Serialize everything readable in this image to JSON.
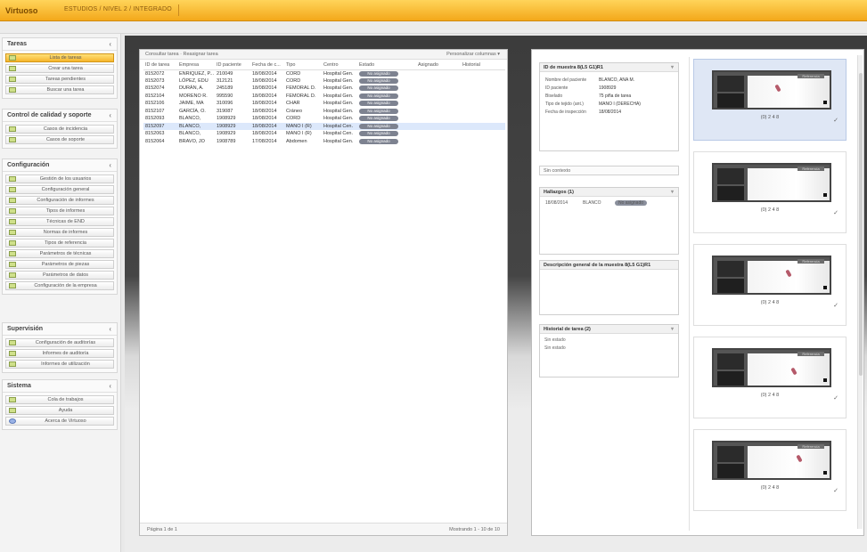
{
  "app": {
    "brand": "Virtuoso",
    "breadcrumb": "ESTUDIOS / NIVEL 2 / INTEGRADO"
  },
  "sidebar": {
    "sections": [
      {
        "title": "Tareas",
        "items": [
          {
            "label": "Lista de tareas",
            "active": true
          },
          {
            "label": "Crear una tarea",
            "active": false
          },
          {
            "label": "Tareas pendientes",
            "active": false
          },
          {
            "label": "Buscar una tarea",
            "active": false
          }
        ]
      },
      {
        "title": "Control de calidad y soporte",
        "items": [
          {
            "label": "Casos de incidencia",
            "active": false
          },
          {
            "label": "Casos de soporte",
            "active": false
          }
        ]
      },
      {
        "title": "Configuración",
        "items": [
          {
            "label": "Gestión de los usuarios",
            "active": false
          },
          {
            "label": "Configuración general",
            "active": false
          },
          {
            "label": "Configuración de informes",
            "active": false
          },
          {
            "label": "Tipos de informes",
            "active": false
          },
          {
            "label": "Técnicas de END",
            "active": false
          },
          {
            "label": "Normas de informes",
            "active": false
          },
          {
            "label": "Tipos de referencia",
            "active": false
          },
          {
            "label": "Parámetros de técnicas",
            "active": false
          },
          {
            "label": "Parámetros de piezas",
            "active": false
          },
          {
            "label": "Parámetros de datos",
            "active": false
          },
          {
            "label": "Configuración de la empresa",
            "active": false
          }
        ]
      },
      {
        "title": "Supervisión",
        "items": [
          {
            "label": "Configuración de auditorías",
            "active": false
          },
          {
            "label": "Informes de auditoría",
            "active": false
          },
          {
            "label": "Informes de utilización",
            "active": false
          }
        ]
      },
      {
        "title": "Sistema",
        "items": [
          {
            "label": "Cola de trabajos",
            "active": false
          },
          {
            "label": "Ayuda",
            "active": false
          },
          {
            "label": "Acerca de Virtuoso",
            "active": false
          }
        ]
      }
    ]
  },
  "grid": {
    "toolbar_left": "Consultar tarea · Reasignar tarea",
    "toolbar_right": "Personalizar columnas ▾",
    "columns": [
      "ID de tarea",
      "Empresa",
      "ID paciente",
      "Fecha de c...",
      "Tipo",
      "Centro",
      "Estado",
      "Asignado",
      "Historial"
    ],
    "rows": [
      {
        "id": "8152072",
        "empresa": "ENRIQUEZ, P...",
        "paciente": "210049",
        "fecha": "18/08/2014",
        "tipo": "CORD",
        "centro": "Hospital Gen.",
        "estado": "No asignado",
        "sel": false
      },
      {
        "id": "8152073",
        "empresa": "LÓPEZ, EDU",
        "paciente": "312121",
        "fecha": "18/08/2014",
        "tipo": "CORD",
        "centro": "Hospital Gen.",
        "estado": "No asignado",
        "sel": false
      },
      {
        "id": "8152074",
        "empresa": "DURÁN, A.",
        "paciente": "245189",
        "fecha": "18/08/2014",
        "tipo": "FEMORAL D.",
        "centro": "Hospital Gen.",
        "estado": "No asignado",
        "sel": false
      },
      {
        "id": "8152104",
        "empresa": "MORENO R.",
        "paciente": "995590",
        "fecha": "18/08/2014",
        "tipo": "FEMORAL D.",
        "centro": "Hospital Gen.",
        "estado": "No asignado",
        "sel": false
      },
      {
        "id": "8152106",
        "empresa": "JAIME, MA",
        "paciente": "310096",
        "fecha": "18/08/2014",
        "tipo": "CHAR",
        "centro": "Hospital Gen.",
        "estado": "No asignado",
        "sel": false
      },
      {
        "id": "8152107",
        "empresa": "GARCÍA, O.",
        "paciente": "319087",
        "fecha": "18/08/2014",
        "tipo": "Cráneo",
        "centro": "Hospital Gen.",
        "estado": "No asignado",
        "sel": false
      },
      {
        "id": "8152093",
        "empresa": "BLANCO,",
        "paciente": "1908929",
        "fecha": "18/08/2014",
        "tipo": "CORD",
        "centro": "Hospital Gen.",
        "estado": "No asignado",
        "sel": false
      },
      {
        "id": "8152097",
        "empresa": "BLANCO,",
        "paciente": "1908929",
        "fecha": "18/08/2014",
        "tipo": "MANO I (R)",
        "centro": "Hospital Cen.",
        "estado": "No asignado",
        "sel": true
      },
      {
        "id": "8152063",
        "empresa": "BLANCO,",
        "paciente": "1908929",
        "fecha": "18/08/2014",
        "tipo": "MANO I (R)",
        "centro": "Hospital Cen.",
        "estado": "No asignado",
        "sel": false
      },
      {
        "id": "8152064",
        "empresa": "BRAVO, JO",
        "paciente": "1908789",
        "fecha": "17/08/2014",
        "tipo": "Abdomen",
        "centro": "Hospital Gen.",
        "estado": "No asignado",
        "sel": false
      }
    ],
    "pager_left": "Página 1 de 1",
    "pager_right": "Mostrando 1 - 10 de 10"
  },
  "detail": {
    "title": "ID de muestra 8(L5 G1)R1",
    "fields": [
      {
        "key": "Nombre del paciente",
        "value": "BLANCO, ANA M."
      },
      {
        "key": "ID paciente",
        "value": "1908929"
      },
      {
        "key": "Biselado",
        "value": "75 piña de tarea"
      },
      {
        "key": "Tipo de tejido (ant.)",
        "value": "MANO I (DERECHA)"
      },
      {
        "key": "Fecha de inspección",
        "value": "18/08/2014"
      }
    ],
    "search_value": "Sin contexto",
    "findings_title": "Hallazgos (1)",
    "findings_row": {
      "date": "18/08/2014",
      "who": "BLANCO",
      "status": "No asignado"
    },
    "general_title": "Descripción general de la muestra 8(L5 G1)R1",
    "history_title": "Historial de tarea (2)",
    "history": [
      "Sin estado",
      "Sin estado"
    ]
  },
  "thumbnails": [
    {
      "caption": "(0) 2 4 8",
      "tag": "Referencia",
      "selected": true
    },
    {
      "caption": "(0) 2 4 8",
      "tag": "Referencia",
      "selected": false
    },
    {
      "caption": "(0) 2 4 8",
      "tag": "Referencia",
      "selected": false
    },
    {
      "caption": "(0) 2 4 8",
      "tag": "Referencia",
      "selected": false
    },
    {
      "caption": "(0) 2 4 8",
      "tag": "Referencia",
      "selected": false
    }
  ],
  "colors": {
    "accent": "#f6b52b",
    "selection": "#dce8fb",
    "pill": "#7d8290"
  }
}
